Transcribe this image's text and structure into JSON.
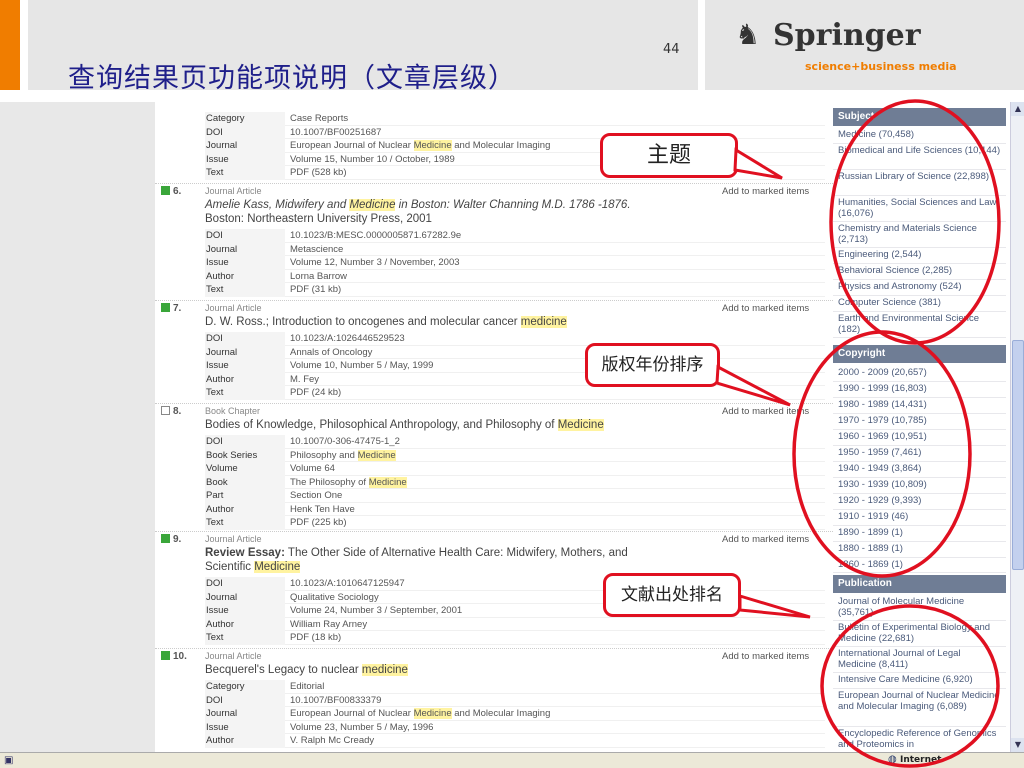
{
  "slide": {
    "title": "查询结果页功能项说明（文章层级）",
    "page_number": "44",
    "logo": {
      "name": "Springer",
      "tagline": "science+business media",
      "icon": "horse-head-icon"
    }
  },
  "callouts": {
    "subject": "主题",
    "copyright": "版权年份排序",
    "publication": "文献出处排名"
  },
  "results": {
    "add_label": "Add to marked items",
    "partial": {
      "meta": [
        {
          "k": "Category",
          "v": "Case Reports"
        },
        {
          "k": "DOI",
          "v": "10.1007/BF00251687"
        },
        {
          "k": "Journal",
          "v": "European Journal of Nuclear Medicine and Molecular Imaging"
        },
        {
          "k": "Issue",
          "v": "Volume 15, Number 10 / October, 1989"
        },
        {
          "k": "Text",
          "v": "PDF (528 kb)"
        }
      ]
    },
    "items": [
      {
        "num": "6.",
        "type": "Journal Article",
        "title_line1": "Amelie Kass, Midwifery and Medicine in Boston: Walter Channing M.D. 1786 -1876.",
        "title_line2": "Boston: Northeastern University Press, 2001",
        "meta": [
          {
            "k": "DOI",
            "v": "10.1023/B:MESC.0000005871.67282.9e"
          },
          {
            "k": "Journal",
            "v": "Metascience"
          },
          {
            "k": "Issue",
            "v": "Volume 12, Number 3 / November, 2003"
          },
          {
            "k": "Author",
            "v": "Lorna Barrow"
          },
          {
            "k": "Text",
            "v": "PDF (31 kb)"
          }
        ]
      },
      {
        "num": "7.",
        "type": "Journal Article",
        "title_line1": "D. W. Ross.; Introduction to oncogenes and molecular cancer medicine",
        "meta": [
          {
            "k": "DOI",
            "v": "10.1023/A:1026446529523"
          },
          {
            "k": "Journal",
            "v": "Annals of Oncology"
          },
          {
            "k": "Issue",
            "v": "Volume 10, Number 5 / May, 1999"
          },
          {
            "k": "Author",
            "v": "M. Fey"
          },
          {
            "k": "Text",
            "v": "PDF (24 kb)"
          }
        ]
      },
      {
        "num": "8.",
        "type": "Book Chapter",
        "title_line1": "Bodies of Knowledge, Philosophical Anthropology, and Philosophy of Medicine",
        "meta": [
          {
            "k": "DOI",
            "v": "10.1007/0-306-47475-1_2"
          },
          {
            "k": "Book Series",
            "v": "Philosophy and Medicine"
          },
          {
            "k": "Volume",
            "v": "Volume 64"
          },
          {
            "k": "Book",
            "v": "The Philosophy of Medicine"
          },
          {
            "k": "Part",
            "v": "Section One"
          },
          {
            "k": "Author",
            "v": "Henk Ten Have"
          },
          {
            "k": "Text",
            "v": "PDF (225 kb)"
          }
        ]
      },
      {
        "num": "9.",
        "type": "Journal Article",
        "title_bold": "Review Essay:",
        "title_line1": "The Other Side of Alternative Health Care: Midwifery, Mothers, and",
        "title_line2": "Scientific Medicine",
        "meta": [
          {
            "k": "DOI",
            "v": "10.1023/A:1010647125947"
          },
          {
            "k": "Journal",
            "v": "Qualitative Sociology"
          },
          {
            "k": "Issue",
            "v": "Volume 24, Number 3 / September, 2001"
          },
          {
            "k": "Author",
            "v": "William Ray Arney"
          },
          {
            "k": "Text",
            "v": "PDF (18 kb)"
          }
        ]
      },
      {
        "num": "10.",
        "type": "Journal Article",
        "title_line1": "Becquerel's Legacy to nuclear medicine",
        "meta": [
          {
            "k": "Category",
            "v": "Editorial"
          },
          {
            "k": "DOI",
            "v": "10.1007/BF00833379"
          },
          {
            "k": "Journal",
            "v": "European Journal of Nuclear Medicine and Molecular Imaging"
          },
          {
            "k": "Issue",
            "v": "Volume 23, Number 5 / May, 1996"
          },
          {
            "k": "Author",
            "v": "V. Ralph Mc Cready"
          }
        ]
      }
    ]
  },
  "facets": {
    "subject": {
      "header": "Subject",
      "items": [
        "Medicine (70,458)",
        "Biomedical and Life Sciences (10,144)",
        "Russian Library of Science (22,898)",
        "Humanities, Social Sciences and Law (16,076)",
        "Chemistry and Materials Science (2,713)",
        "Engineering (2,544)",
        "Behavioral Science (2,285)",
        "Physics and Astronomy (524)",
        "Computer Science (381)",
        "Earth and Environmental Science (182)"
      ]
    },
    "copyright": {
      "header": "Copyright",
      "items": [
        "2000 - 2009 (20,657)",
        "1990 - 1999 (16,803)",
        "1980 - 1989 (14,431)",
        "1970 - 1979 (10,785)",
        "1960 - 1969 (10,951)",
        "1950 - 1959 (7,461)",
        "1940 - 1949 (3,864)",
        "1930 - 1939 (10,809)",
        "1920 - 1929 (9,393)",
        "1910 - 1919 (46)",
        "1890 - 1899 (1)",
        "1880 - 1889 (1)",
        "1860 - 1869 (1)"
      ]
    },
    "publication": {
      "header": "Publication",
      "items": [
        "Journal of Molecular Medicine (35,761)",
        "Bulletin of Experimental Biology and Medicine (22,681)",
        "International Journal of Legal Medicine (8,411)",
        "Intensive Care Medicine (6,920)",
        "European Journal of Nuclear Medicine and Molecular Imaging (6,089)",
        "Encyclopedic Reference of Genomics and Proteomics in"
      ]
    }
  },
  "status": {
    "zone": "Internet",
    "page_icon": "ie-page-icon",
    "zone_icon": "globe-icon"
  },
  "colors": {
    "accent": "#f07d00",
    "highlight": "#fff3a0",
    "facet_header": "#6f7d95",
    "callout_border": "#e01020",
    "title": "#1f1f8a"
  }
}
